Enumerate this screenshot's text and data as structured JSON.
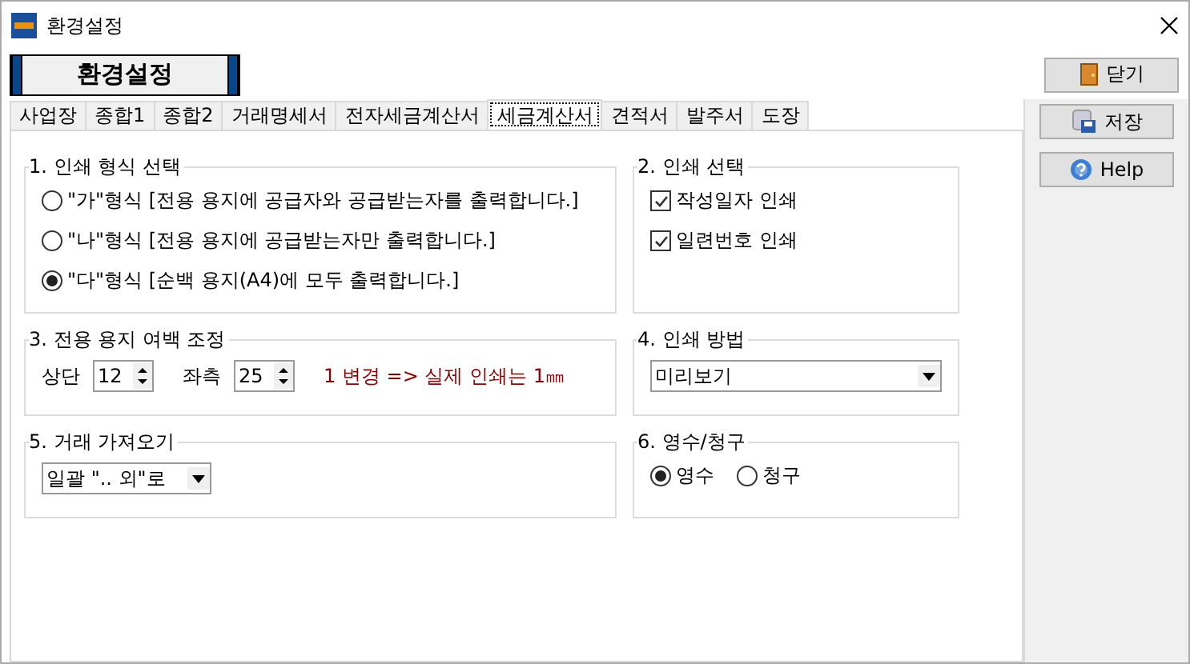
{
  "window": {
    "title": "환경설정"
  },
  "banner": "환경설정",
  "close_button": "닫기",
  "tabs": [
    {
      "label": "사업장",
      "selected": false
    },
    {
      "label": "종합1",
      "selected": false
    },
    {
      "label": "종합2",
      "selected": false
    },
    {
      "label": "거래명세서",
      "selected": false
    },
    {
      "label": "전자세금계산서",
      "selected": false
    },
    {
      "label": "세금계산서",
      "selected": true
    },
    {
      "label": "견적서",
      "selected": false
    },
    {
      "label": "발주서",
      "selected": false
    },
    {
      "label": "도장",
      "selected": false
    }
  ],
  "side_buttons": [
    {
      "label": "저장",
      "kind": "save"
    },
    {
      "label": "Help",
      "kind": "help"
    }
  ],
  "print_format": {
    "title": "1. 인쇄 형식 선택",
    "options": [
      {
        "label": "\"가\"형식 [전용 용지에 공급자와 공급받는자를 출력합니다.]",
        "selected": false
      },
      {
        "label": "\"나\"형식 [전용 용지에 공급받는자만 출력합니다.]",
        "selected": false
      },
      {
        "label": "\"다\"형식 [순백 용지(A4)에 모두 출력합니다.]",
        "selected": true
      }
    ]
  },
  "print_select": {
    "title": "2. 인쇄 선택",
    "options": [
      {
        "label": "작성일자 인쇄",
        "checked": true
      },
      {
        "label": "일련번호 인쇄",
        "checked": true
      }
    ]
  },
  "margin": {
    "title": "3. 전용 용지 여백 조정",
    "fields": [
      {
        "label": "상단",
        "value": "12"
      },
      {
        "label": "좌측",
        "value": "25"
      }
    ],
    "note": "1 변경 => 실제 인쇄는 1㎜"
  },
  "print_method": {
    "title": "4. 인쇄 방법",
    "value": "미리보기"
  },
  "import": {
    "title": "5. 거래 가져오기",
    "value": "일괄 \".. 외\"로"
  },
  "receipt": {
    "title": "6. 영수/청구",
    "options": [
      {
        "label": "영수",
        "selected": true
      },
      {
        "label": "청구",
        "selected": false
      }
    ]
  }
}
